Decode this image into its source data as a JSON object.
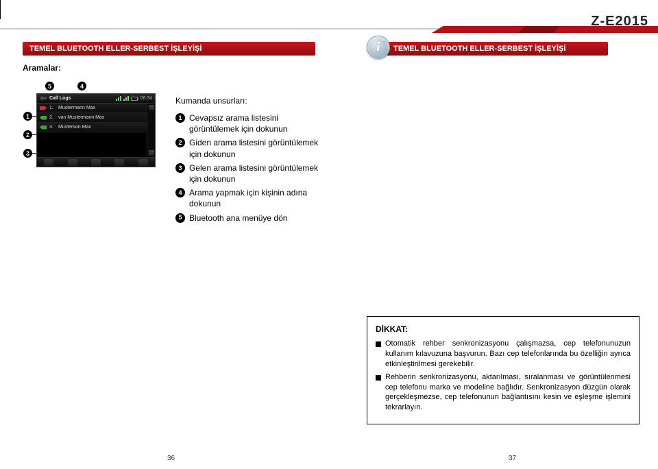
{
  "model": "Z-E2015",
  "banner_left": "TEMEL BLUETOOTH ELLER-SERBEST İŞLEYİŞİ",
  "banner_right": "TEMEL BLUETOOTH ELLER-SERBEST İŞLEYİŞİ",
  "subheading": "Aramalar:",
  "callouts": {
    "n1": "1",
    "n2": "2",
    "n3": "3",
    "n4": "4",
    "n5": "5"
  },
  "device": {
    "title": "Call Logs",
    "time": "06:34",
    "rows": [
      {
        "num": "1.",
        "name": "Mustermann Max"
      },
      {
        "num": "2.",
        "name": "van Mustermann Max"
      },
      {
        "num": "3.",
        "name": "Musterson Max"
      }
    ]
  },
  "controls_heading": "Kumanda unsurları:",
  "controls": [
    "Cevapsız arama listesini görüntülemek için dokunun",
    "Giden arama listesini görüntülemek için dokunun",
    "Gelen arama listesini görüntülemek için dokunun",
    "Arama yapmak için kişinin adına dokunun",
    "Bluetooth ana menüye dön"
  ],
  "note": {
    "title": "DİKKAT:",
    "items": [
      "Otomatik rehber senkronizasyonu çalışmazsa, cep telefonunuzun kullanım kılavuzuna başvurun. Bazı cep telefonlarında bu özelliğin ayrıca etkinleştirilmesi gerekebilir.",
      "Rehberin senkronizasyonu, aktarılması, sıralanması ve görüntülenmesi cep telefonu marka ve modeline bağlıdır. Senkronizasyon düzgün olarak gerçekleşmezse, cep telefonunun bağlantısını kesin ve eşleşme işlemini tekrarlayın."
    ]
  },
  "page_left": "36",
  "page_right": "37"
}
